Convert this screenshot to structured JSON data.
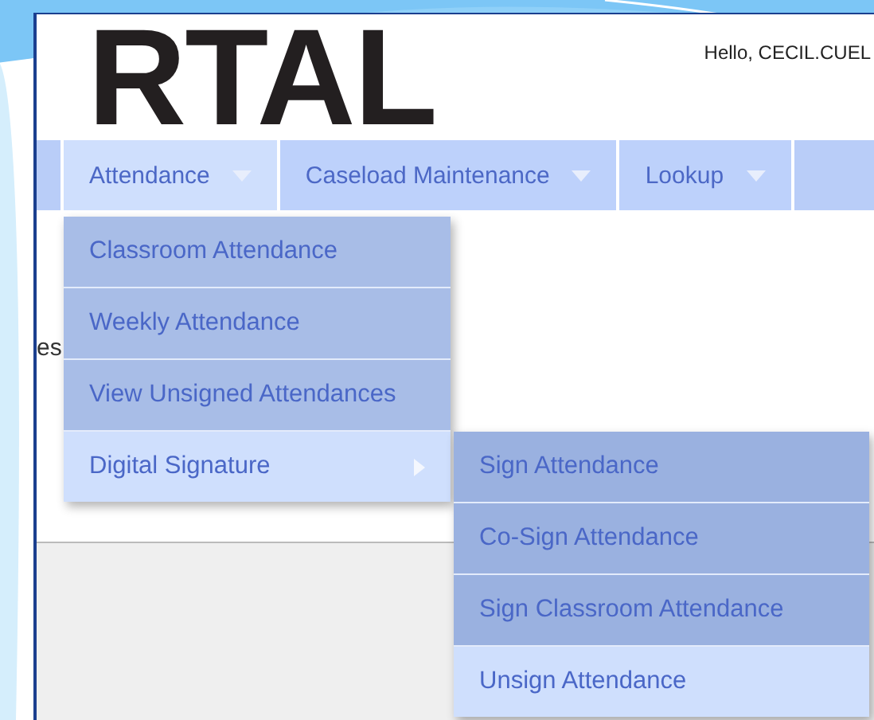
{
  "header": {
    "logo": "RTAL",
    "greeting": "Hello, CECIL.CUEL"
  },
  "nav": [
    {
      "label": "Attendance",
      "selected": true
    },
    {
      "label": "Caseload Maintenance",
      "selected": false
    },
    {
      "label": "Lookup",
      "selected": false
    }
  ],
  "menu": [
    {
      "label": "Classroom Attendance",
      "kind": "item",
      "selected": false
    },
    {
      "label": "Weekly Attendance",
      "kind": "item",
      "selected": false
    },
    {
      "label": "View Unsigned Attendances",
      "kind": "item",
      "selected": false
    },
    {
      "label": "Digital Signature",
      "kind": "submenu",
      "selected": true
    }
  ],
  "submenu": [
    {
      "label": "Sign Attendance",
      "kind": "item",
      "selected": false
    },
    {
      "label": "Co-Sign Attendance",
      "kind": "item",
      "selected": false
    },
    {
      "label": "Sign Classroom Attendance",
      "kind": "item",
      "selected": false
    },
    {
      "label": "Unsign Attendance",
      "kind": "item",
      "selected": true
    }
  ],
  "page_fragments": [
    "es"
  ]
}
